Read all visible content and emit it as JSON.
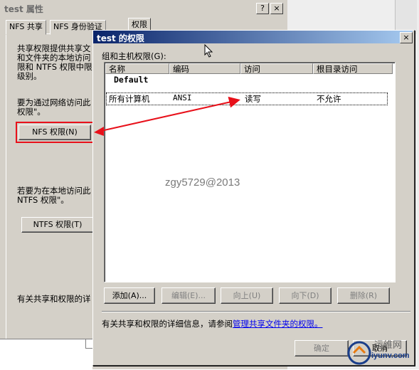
{
  "background_window": {
    "title": "test 属性",
    "help_button": "?",
    "close_button": "×",
    "tabs": [
      "NFS 共享",
      "NFS 身份验证",
      "权限"
    ],
    "text1": "共享权限提供共享文\n和文件夹的本地访问\n限和 NTFS 权限中限\n级别。",
    "text2": "要为通过网络访问此\n权限\"。",
    "nfs_button": "NFS 权限(N)",
    "text3": "若要为在本地访问此\nNTFS 权限\"。",
    "ntfs_button": "NTFS 权限(T)",
    "text4": "有关共享和权限的详"
  },
  "dialog": {
    "title": "test 的权限",
    "close_button": "×",
    "group_label": "组和主机权限(G):",
    "columns": [
      "名称",
      "编码",
      "访问",
      "根目录访问"
    ],
    "default_group": "Default",
    "rows": [
      {
        "name": "所有计算机",
        "encoding": "ANSI",
        "access": "读写",
        "root_access": "不允许"
      }
    ],
    "buttons": {
      "add": "添加(A)...",
      "edit": "编辑(E)...",
      "up": "向上(U)",
      "down": "向下(D)",
      "delete": "删除(R)"
    },
    "info_prefix": "有关共享和权限的详细信息，请参阅",
    "info_link": "管理共享文件夹的权限。",
    "ok": "确定",
    "cancel": "取消"
  },
  "annotations": {
    "watermark": "zgy5729@2013",
    "logo_text": "iyunv.com",
    "logo_cn": "运维网",
    "highlight_color": "#e8101a"
  }
}
